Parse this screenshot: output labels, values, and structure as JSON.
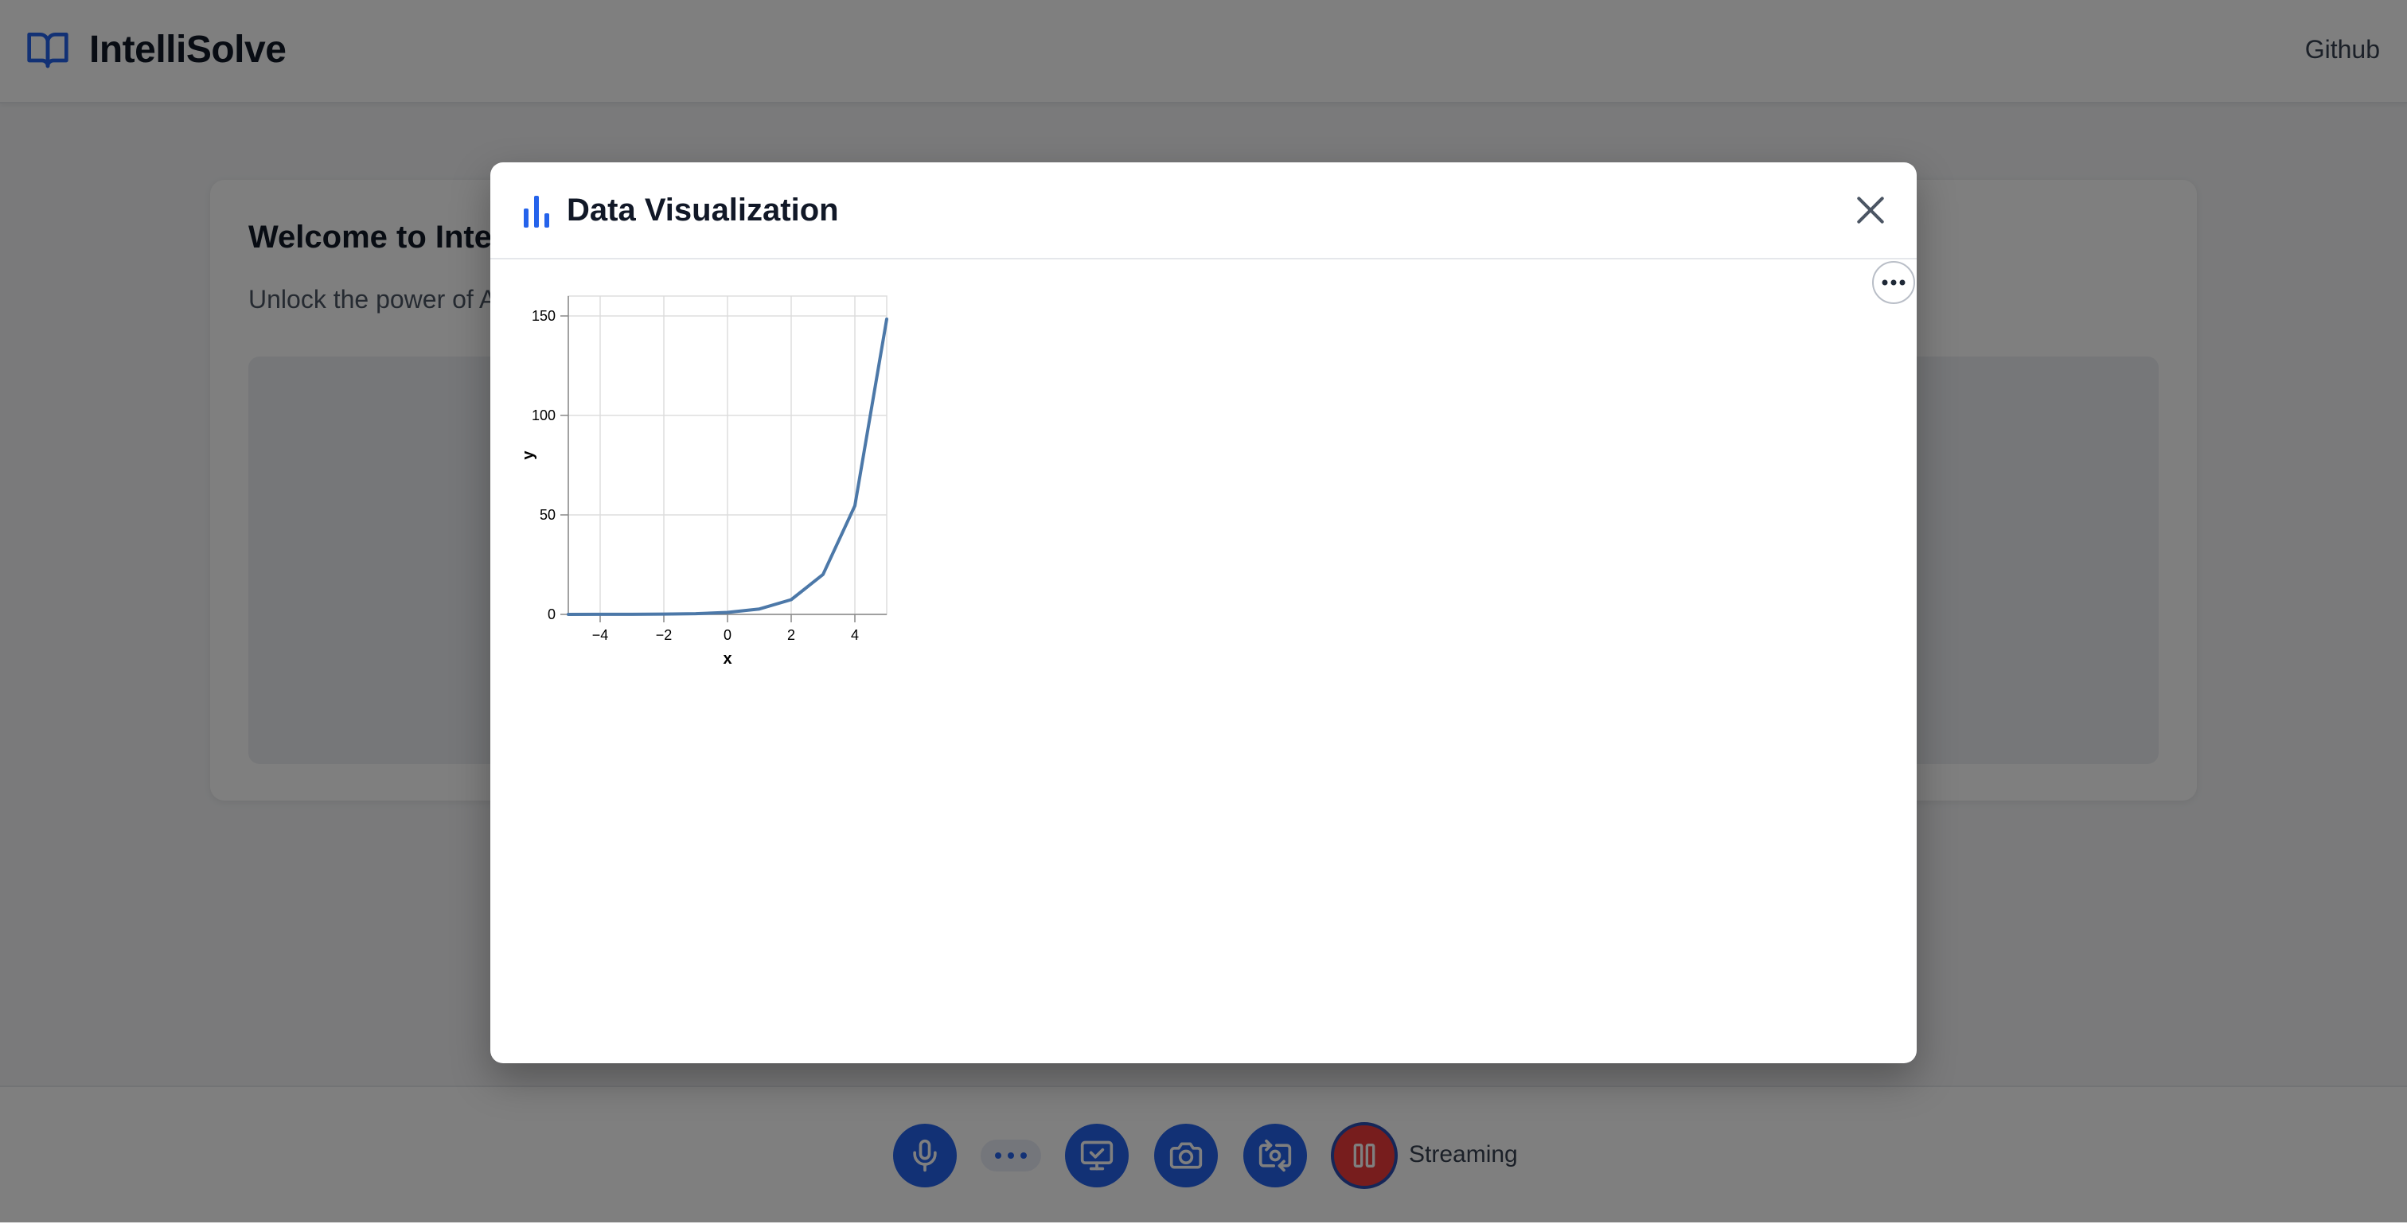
{
  "app": {
    "title": "IntelliSolve",
    "github_label": "Github"
  },
  "welcome": {
    "title": "Welcome to IntelliSolve",
    "subtitle": "Unlock the power of AI"
  },
  "controls": {
    "items": [
      "microphone-icon",
      "more-options-icon",
      "screen-share-icon",
      "camera-icon",
      "switch-camera-icon",
      "pause-icon"
    ],
    "streaming_label": "Streaming",
    "accent": "#2563eb",
    "stop_color": "#ef3b3b"
  },
  "modal": {
    "title": "Data Visualization",
    "title_icon": "bar-chart-icon",
    "close_icon": "close-icon",
    "actions_icon": "ellipsis-icon"
  },
  "chart_data": {
    "type": "line",
    "title": "",
    "xlabel": "x",
    "ylabel": "y",
    "xlim": [
      -5,
      5
    ],
    "ylim": [
      0,
      160
    ],
    "xticks": [
      -4,
      -2,
      0,
      2,
      4
    ],
    "yticks": [
      0,
      50,
      100,
      150
    ],
    "xtick_labels": [
      "−4",
      "−2",
      "0",
      "2",
      "4"
    ],
    "ytick_labels": [
      "0",
      "50",
      "100",
      "150"
    ],
    "grid": true,
    "series": [
      {
        "name": "",
        "color": "#4c78a8",
        "x": [
          -5,
          -4,
          -3,
          -2,
          -1,
          0,
          1,
          2,
          3,
          4,
          5
        ],
        "y": [
          0.01,
          0.02,
          0.05,
          0.14,
          0.37,
          1,
          2.72,
          7.39,
          20.09,
          54.6,
          148.41
        ]
      }
    ]
  }
}
